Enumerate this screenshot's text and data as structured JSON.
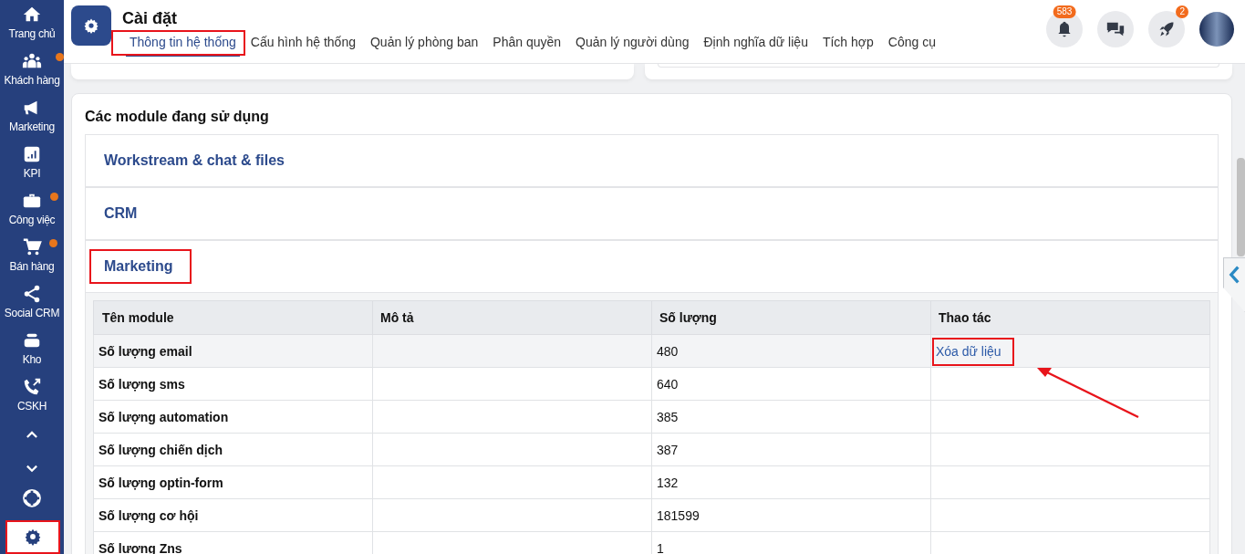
{
  "sidebar": {
    "items": [
      {
        "label": "Trang chủ",
        "kind": "home",
        "dot": false
      },
      {
        "label": "Khách hàng",
        "kind": "people",
        "dot": true
      },
      {
        "label": "Marketing",
        "kind": "megaphone",
        "dot": false
      },
      {
        "label": "KPI",
        "kind": "chart",
        "dot": false
      },
      {
        "label": "Công việc",
        "kind": "briefcase",
        "dot": true
      },
      {
        "label": "Bán hàng",
        "kind": "cart",
        "dot": true
      },
      {
        "label": "Social CRM",
        "kind": "share",
        "dot": false
      },
      {
        "label": "Kho",
        "kind": "box",
        "dot": false
      },
      {
        "label": "CSKH",
        "kind": "phone",
        "dot": false
      }
    ],
    "settings_highlighted": true
  },
  "header": {
    "title": "Cài đặt",
    "tabs": [
      {
        "label": "Thông tin hệ thống",
        "selected": true,
        "highlighted": true
      },
      {
        "label": "Cấu hình hệ thống",
        "selected": false,
        "highlighted": false
      },
      {
        "label": "Quản lý phòng ban",
        "selected": false,
        "highlighted": false
      },
      {
        "label": "Phân quyền",
        "selected": false,
        "highlighted": false
      },
      {
        "label": "Quản lý người dùng",
        "selected": false,
        "highlighted": false
      },
      {
        "label": "Định nghĩa dữ liệu",
        "selected": false,
        "highlighted": false
      },
      {
        "label": "Tích hợp",
        "selected": false,
        "highlighted": false
      },
      {
        "label": "Công cụ",
        "selected": false,
        "highlighted": false
      }
    ],
    "notification_count": "583",
    "rocket_count": "2"
  },
  "modules": {
    "title": "Các module đang sử dụng",
    "sections": [
      {
        "title": "Workstream & chat & files",
        "expanded": false,
        "highlighted": false
      },
      {
        "title": "CRM",
        "expanded": false,
        "highlighted": false
      },
      {
        "title": "Marketing",
        "expanded": true,
        "highlighted": true
      }
    ]
  },
  "table": {
    "columns": [
      "Tên module",
      "Mô tả",
      "Số lượng",
      "Thao tác"
    ],
    "rows": [
      {
        "name": "Số lượng email",
        "count": "480",
        "action": "Xóa dữ liệu",
        "action_highlighted": true,
        "selected": true
      },
      {
        "name": "Số lượng sms",
        "count": "640",
        "selected": false
      },
      {
        "name": "Số lượng automation",
        "count": "385",
        "selected": false
      },
      {
        "name": "Số lượng chiến dịch",
        "count": "387",
        "selected": false
      },
      {
        "name": "Số lượng optin-form",
        "count": "132",
        "selected": false
      },
      {
        "name": "Số lượng cơ hội",
        "count": "181599",
        "selected": false
      },
      {
        "name": "Số lượng Zns",
        "count": "1",
        "selected": false
      }
    ]
  }
}
